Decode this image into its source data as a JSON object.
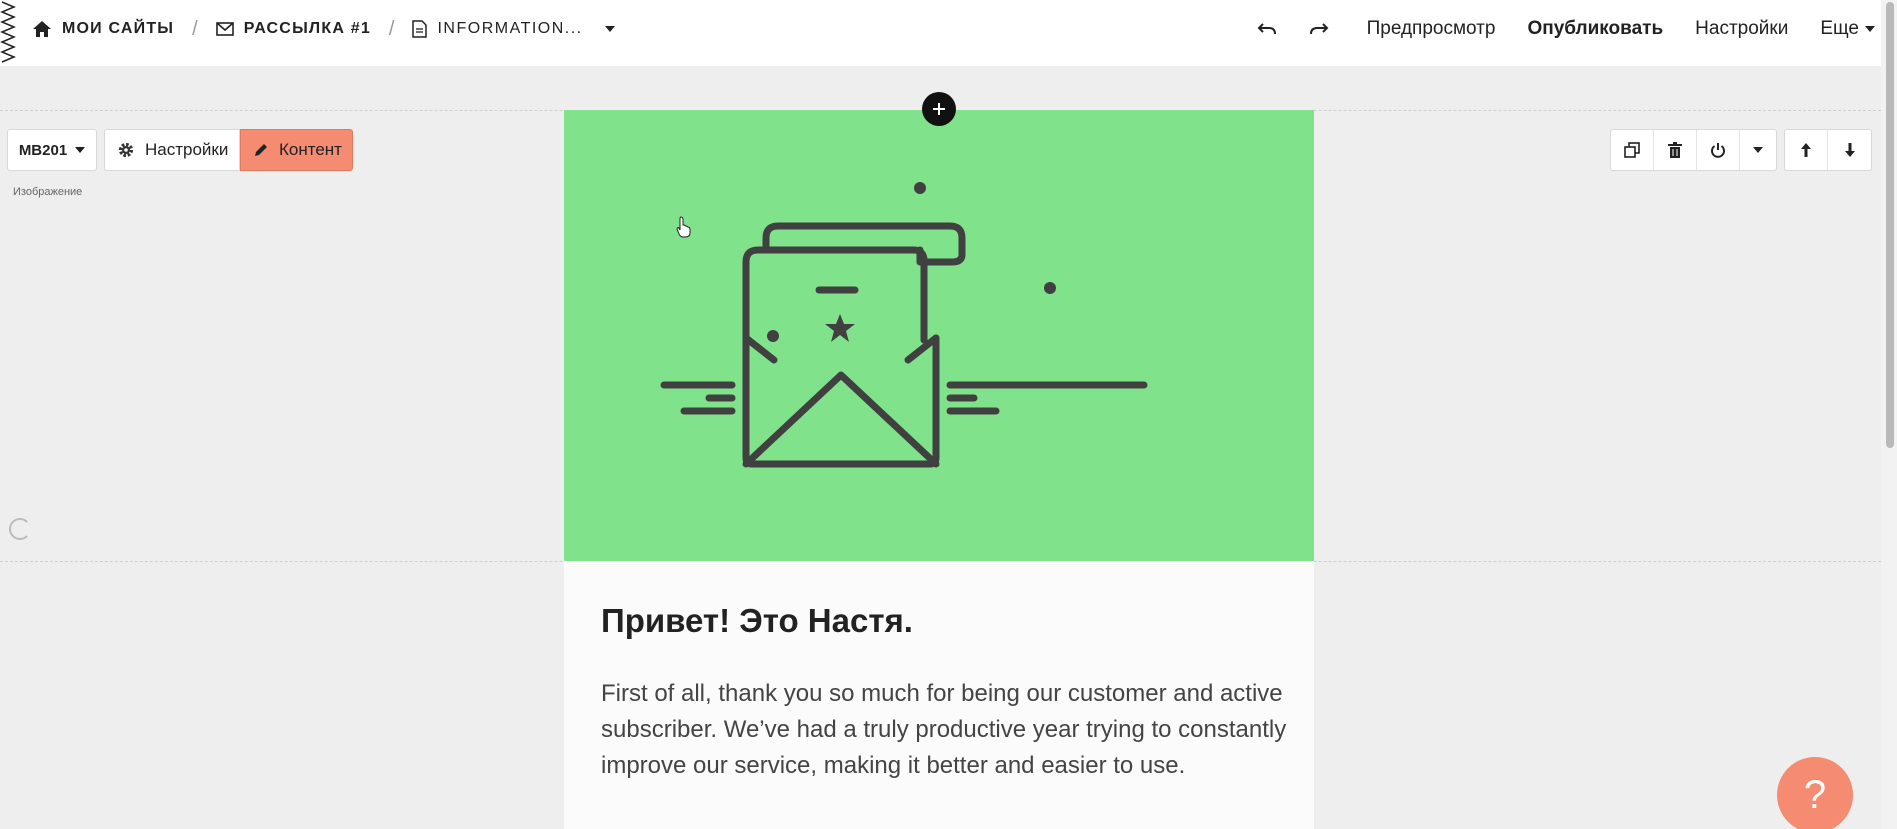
{
  "breadcrumbs": {
    "home_label": "МОИ САЙТЫ",
    "mailing_label": "РАССЫЛКА #1",
    "page_label": "INFORMATION..."
  },
  "header_actions": {
    "preview": "Предпросмотр",
    "publish": "Опубликовать",
    "settings": "Настройки",
    "more": "Еще"
  },
  "block_toolbar": {
    "block_id": "MB201",
    "settings_label": "Настройки",
    "content_label": "Контент",
    "block_type_label": "Изображение"
  },
  "email": {
    "headline": "Привет! Это Настя.",
    "body": "First of all, thank you so much for being our customer and active subscriber. We’ve had a truly productive year trying to constantly improve our service, making it better and easier to use.",
    "hero_color": "#80e28a"
  },
  "help": {
    "label": "?"
  },
  "colors": {
    "accent": "#f58c72",
    "hero": "#80e28a"
  }
}
